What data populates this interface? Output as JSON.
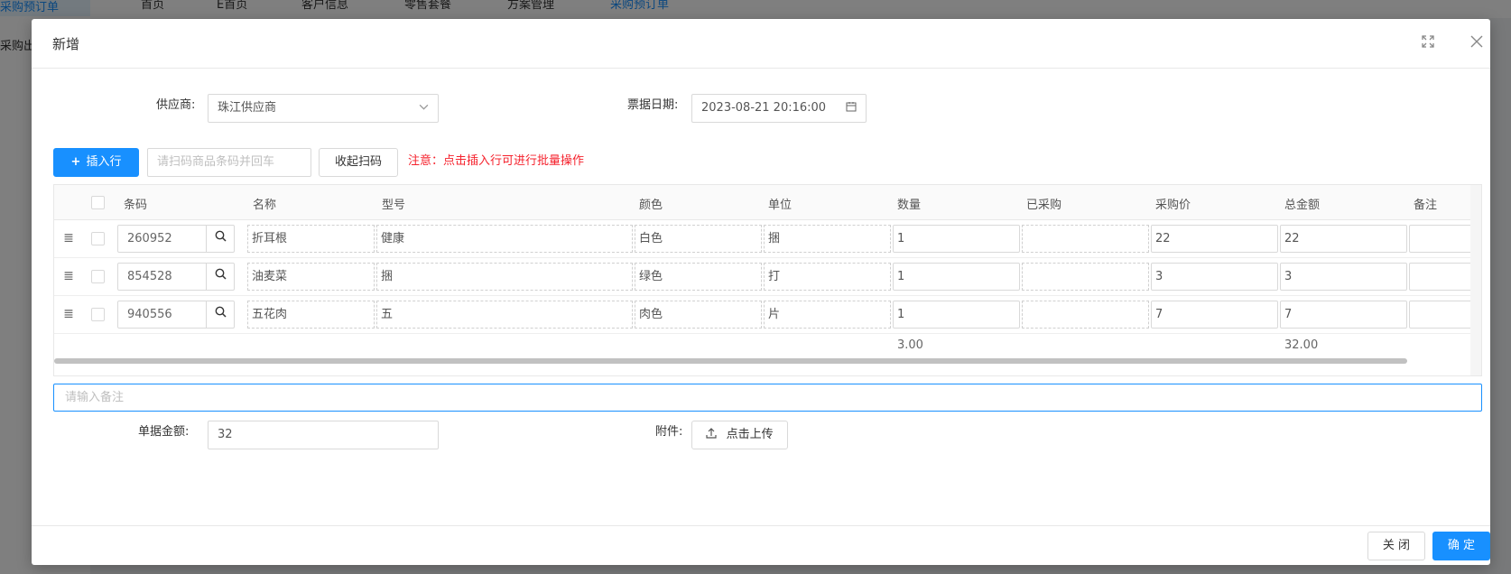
{
  "background": {
    "sidebar_items": [
      "采购预订单",
      "采购出入"
    ],
    "tabs": [
      "首页",
      "E首页",
      "客户信息",
      "零售套餐",
      "方案管理",
      "采购预订单"
    ]
  },
  "modal": {
    "title": "新增",
    "supplier_label": "供应商:",
    "supplier_value": "珠江供应商",
    "date_label": "票据日期:",
    "date_value": "2023-08-21 20:16:00",
    "insert_row_label": "插入行",
    "scan_placeholder": "请扫码商品条码并回车",
    "collapse_scan_label": "收起扫码",
    "notice": "注意：点击插入行可进行批量操作",
    "remark_placeholder": "请输入备注",
    "amount_label": "单据金额:",
    "amount_value": "32",
    "attachment_label": "附件:",
    "upload_label": "点击上传",
    "close_label": "关 闭",
    "confirm_label": "确 定"
  },
  "table": {
    "headers": [
      "条码",
      "名称",
      "型号",
      "颜色",
      "单位",
      "数量",
      "已采购",
      "采购价",
      "总金额",
      "备注"
    ],
    "rows": [
      {
        "code": "260952",
        "name": "折耳根",
        "model": "健康",
        "color": "白色",
        "unit": "捆",
        "qty": "1",
        "purchased": "",
        "price": "22",
        "total": "22",
        "remark": ""
      },
      {
        "code": "854528",
        "name": "油麦菜",
        "model": "捆",
        "color": "绿色",
        "unit": "打",
        "qty": "1",
        "purchased": "",
        "price": "3",
        "total": "3",
        "remark": ""
      },
      {
        "code": "940556",
        "name": "五花肉",
        "model": "五",
        "color": "肉色",
        "unit": "片",
        "qty": "1",
        "purchased": "",
        "price": "7",
        "total": "7",
        "remark": ""
      }
    ],
    "sum_qty": "3.00",
    "sum_total": "32.00"
  }
}
